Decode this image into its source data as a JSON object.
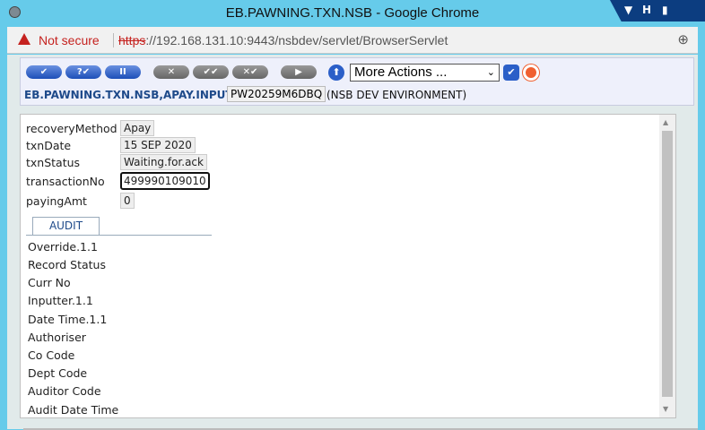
{
  "window": {
    "title": "EB.PAWNING.TXN.NSB - Google Chrome"
  },
  "address": {
    "security": "Not secure",
    "scheme": "https",
    "url_rest": "://192.168.131.10:9443/nsbdev/servlet/BrowserServlet"
  },
  "toolbar": {
    "buttons": [
      {
        "label": "✔",
        "enabled": true
      },
      {
        "label": "?✔",
        "enabled": true
      },
      {
        "label": "II",
        "enabled": true
      },
      {
        "label": "✕",
        "enabled": false
      },
      {
        "label": "✔✔",
        "enabled": false
      },
      {
        "label": "✕✔",
        "enabled": false
      },
      {
        "label": "▶",
        "enabled": false
      }
    ],
    "more_actions": "More Actions ...",
    "app": "EB.PAWNING.TXN.NSB,APAY.INPUT",
    "txn_id": "PW20259M6DBQ",
    "environment": "(NSB DEV ENVIRONMENT)"
  },
  "fields": [
    {
      "label": "recoveryMethod",
      "value": "Apay"
    },
    {
      "label": "txnDate",
      "value": "15 SEP 2020"
    },
    {
      "label": "txnStatus",
      "value": "Waiting.for.ack"
    },
    {
      "label": "transactionNo",
      "value": "499990109010"
    },
    {
      "label": "payingAmt",
      "value": "0"
    }
  ],
  "audit": {
    "tab": "AUDIT",
    "items": [
      "Override.1.1",
      "Record Status",
      "Curr No",
      "Inputter.1.1",
      "Date Time.1.1",
      "Authoriser",
      "Co Code",
      "Dept Code",
      "Auditor Code",
      "Audit Date Time"
    ]
  }
}
